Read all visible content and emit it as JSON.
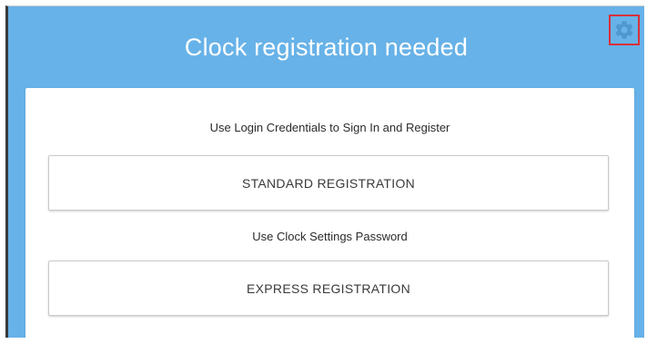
{
  "header": {
    "title": "Clock registration needed",
    "settings_icon": "gear-icon"
  },
  "standard": {
    "description": "Use Login Credentials to Sign In and Register",
    "button_label": "STANDARD REGISTRATION"
  },
  "express": {
    "description": "Use Clock Settings Password",
    "button_label": "EXPRESS REGISTRATION"
  },
  "colors": {
    "background": "#67b2e8",
    "gear": "#4f97cf",
    "highlight": "#d9303a",
    "card": "#ffffff"
  }
}
